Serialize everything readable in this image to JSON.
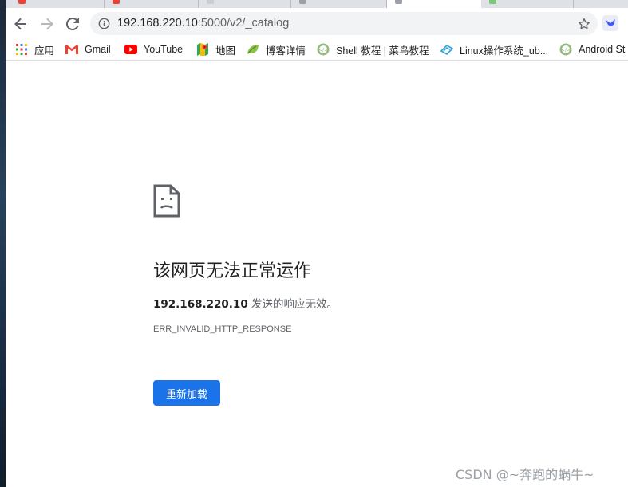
{
  "browser": {
    "address_bar": {
      "host": "192.168.220.10",
      "rest": ":5000/v2/_catalog"
    }
  },
  "bookmarks": [
    {
      "label": "应用",
      "icon": "apps-grid-icon"
    },
    {
      "label": "Gmail",
      "icon": "gmail-icon"
    },
    {
      "label": "YouTube",
      "icon": "youtube-icon"
    },
    {
      "label": "地图",
      "icon": "maps-icon"
    },
    {
      "label": "博客详情",
      "icon": "leaf-icon"
    },
    {
      "label": "Shell 教程 | 菜鸟教程",
      "icon": "runoob-icon"
    },
    {
      "label": "Linux操作系统_ub...",
      "icon": "network-icon"
    },
    {
      "label": "Android St",
      "icon": "runoob-icon"
    }
  ],
  "error_page": {
    "title": "该网页无法正常运作",
    "host_bold": "192.168.220.10",
    "desc_suffix": " 发送的响应无效。",
    "code": "ERR_INVALID_HTTP_RESPONSE",
    "reload_label": "重新加载"
  },
  "watermark": "CSDN @~奔跑的蜗牛~",
  "colors": {
    "accent_blue": "#1a73e8",
    "youtube_red": "#ff0000",
    "gmail_red": "#ea4335",
    "text_primary": "#202124",
    "text_secondary": "#5f6368"
  }
}
